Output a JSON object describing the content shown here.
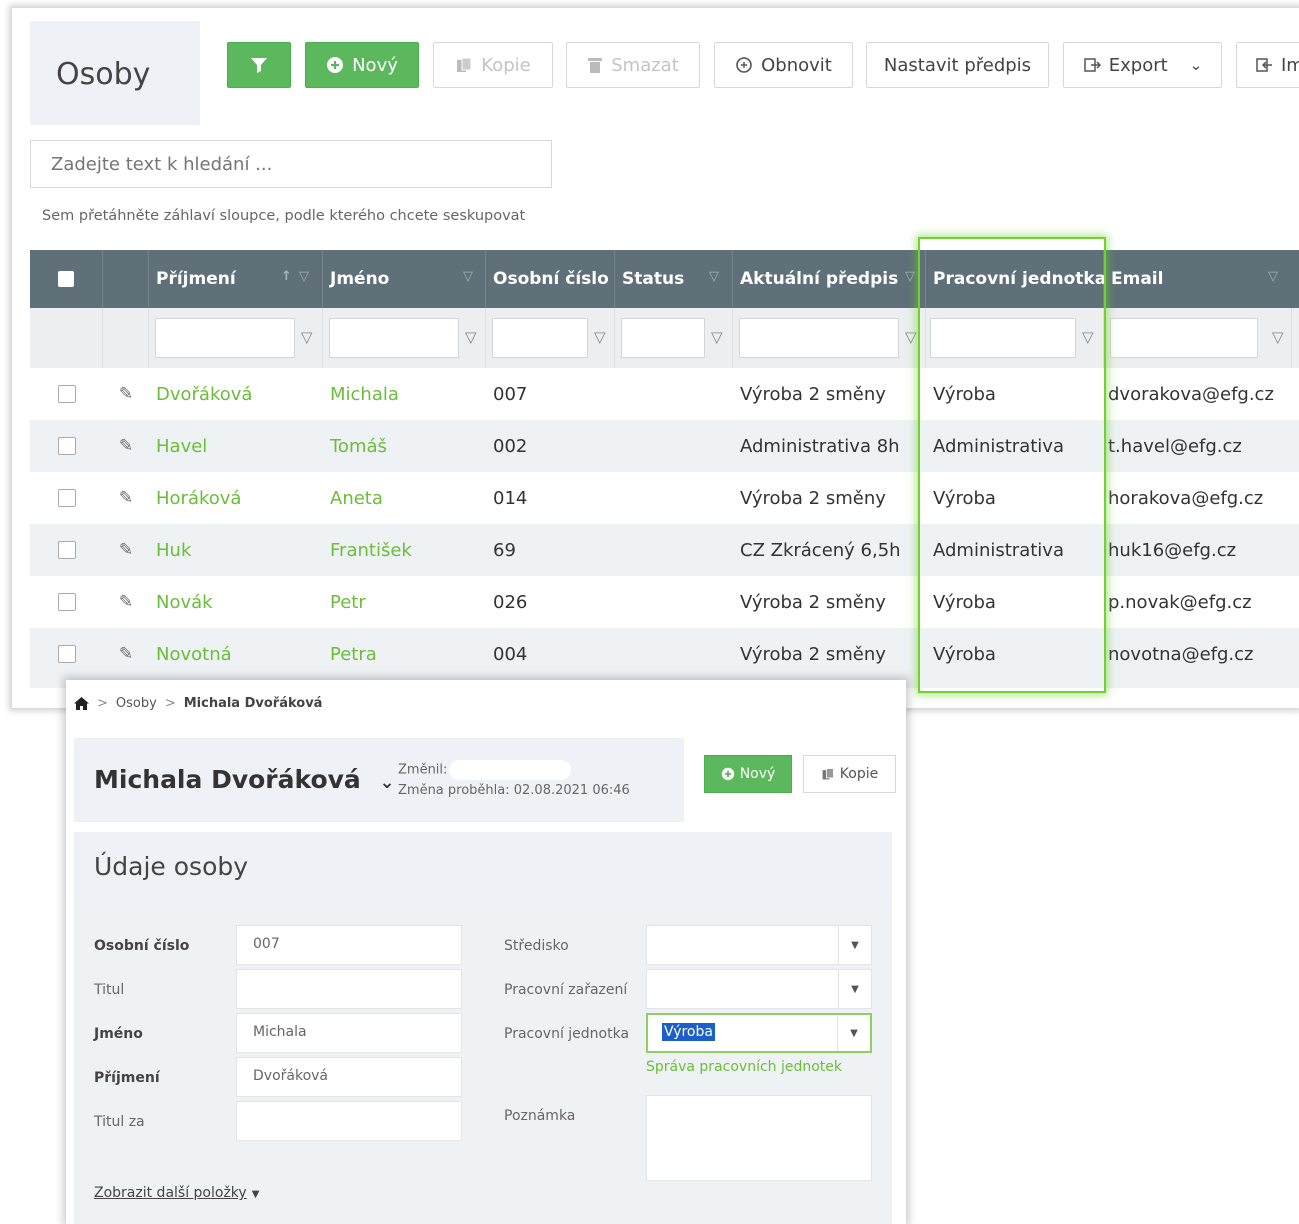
{
  "list": {
    "title": "Osoby",
    "toolbar": {
      "new_label": "Nový",
      "copy_label": "Kopie",
      "delete_label": "Smazat",
      "refresh_label": "Obnovit",
      "set_rule_label": "Nastavit předpis",
      "export_label": "Export",
      "import_label": "Im"
    },
    "search_placeholder": "Zadejte text k hledání ...",
    "group_hint": "Sem přetáhněte záhlaví sloupce, podle kterého chcete seskupovat",
    "columns": [
      "Příjmení",
      "Jméno",
      "Osobní číslo",
      "Status",
      "Aktuální předpis",
      "Pracovní jednotka",
      "Email"
    ],
    "rows": [
      {
        "surname": "Dvořáková",
        "name": "Michala",
        "number": "007",
        "status": "",
        "rule": "Výroba 2 směny",
        "unit": "Výroba",
        "email": "dvorakova@efg.cz"
      },
      {
        "surname": "Havel",
        "name": "Tomáš",
        "number": "002",
        "status": "",
        "rule": "Administrativa 8h",
        "unit": "Administrativa",
        "email": "t.havel@efg.cz"
      },
      {
        "surname": "Horáková",
        "name": "Aneta",
        "number": "014",
        "status": "",
        "rule": "Výroba 2 směny",
        "unit": "Výroba",
        "email": "horakova@efg.cz"
      },
      {
        "surname": "Huk",
        "name": "František",
        "number": "69",
        "status": "",
        "rule": "CZ Zkrácený 6,5h",
        "unit": "Administrativa",
        "email": "huk16@efg.cz"
      },
      {
        "surname": "Novák",
        "name": "Petr",
        "number": "026",
        "status": "",
        "rule": "Výroba 2 směny",
        "unit": "Výroba",
        "email": "p.novak@efg.cz"
      },
      {
        "surname": "Novotná",
        "name": "Petra",
        "number": "004",
        "status": "",
        "rule": "Výroba 2 směny",
        "unit": "Výroba",
        "email": "novotna@efg.cz"
      }
    ]
  },
  "detail": {
    "breadcrumb": {
      "section": "Osoby",
      "current": "Michala Dvořáková"
    },
    "person_name": "Michala Dvořáková",
    "changed_by_label": "Změnil:",
    "changed_at": "Změna proběhla: 02.08.2021 06:46",
    "new_label": "Nový",
    "copy_label": "Kopie",
    "section_title": "Údaje osoby",
    "fields": {
      "number_label": "Osobní číslo",
      "number_value": "007",
      "title_label": "Titul",
      "title_value": "",
      "name_label": "Jméno",
      "name_value": "Michala",
      "surname_label": "Příjmení",
      "surname_value": "Dvořáková",
      "title_after_label": "Titul za",
      "title_after_value": "",
      "center_label": "Středisko",
      "position_label": "Pracovní zařazení",
      "unit_label": "Pracovní jednotka",
      "unit_value": "Výroba",
      "manage_units_link": "Správa pracovních jednotek",
      "note_label": "Poznámka"
    },
    "more_items_link": "Zobrazit další položky"
  },
  "colors": {
    "accent_green": "#5cb85c",
    "link_green": "#6bbd3a",
    "header_gray": "#5f7078",
    "highlight_green": "#71d132"
  }
}
